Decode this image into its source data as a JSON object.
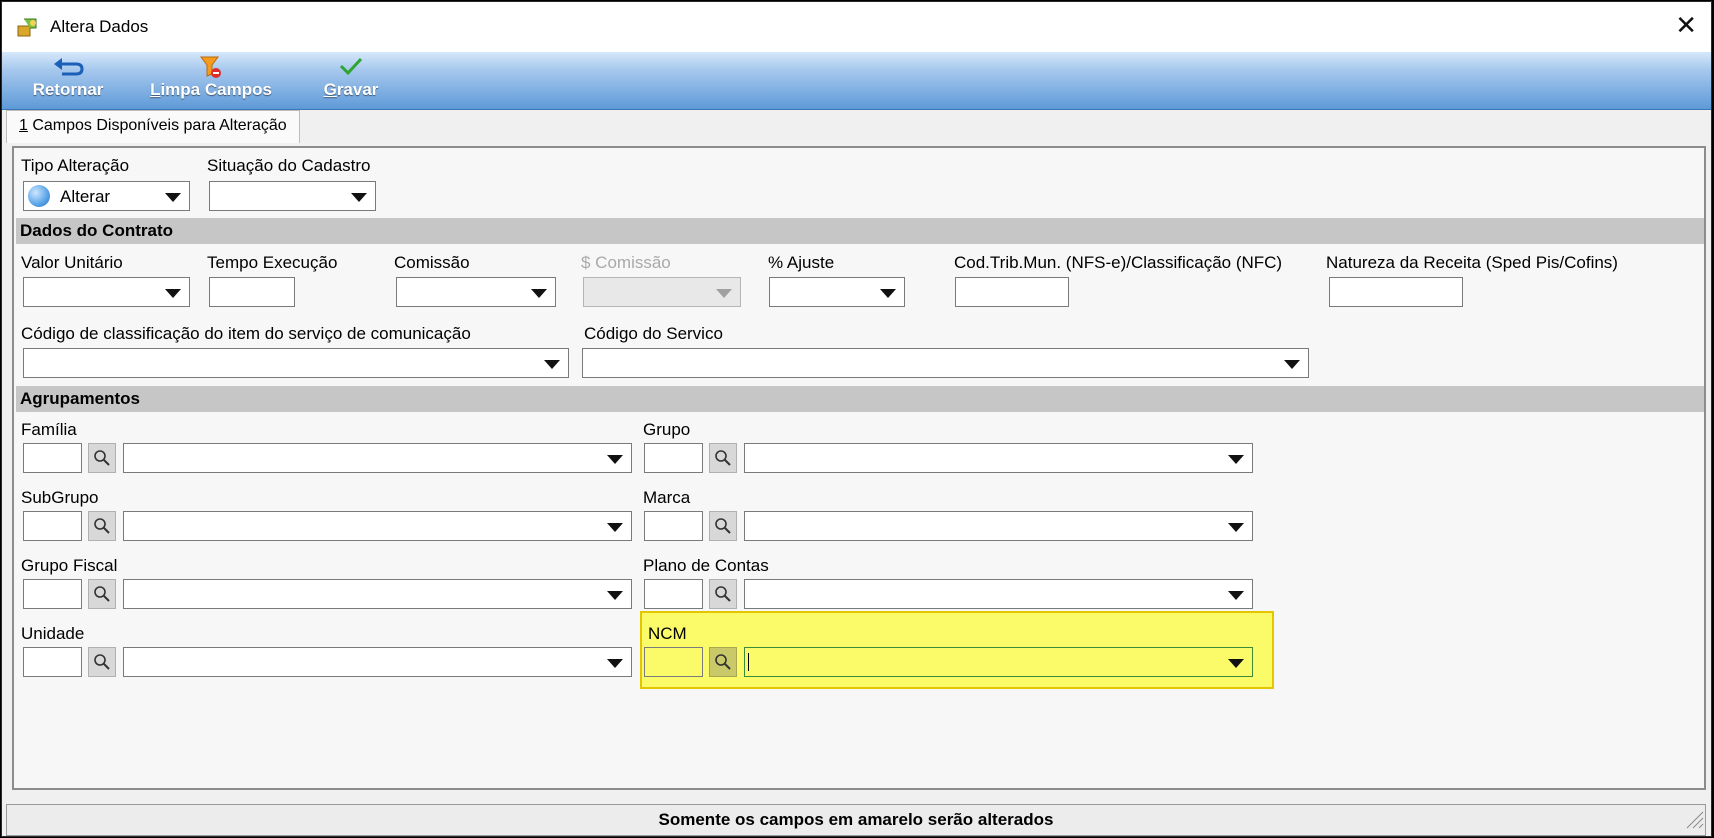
{
  "window": {
    "title": "Altera Dados",
    "close_glyph": "✕"
  },
  "toolbar": {
    "retornar": {
      "hotkey": "",
      "rest": "Retornar",
      "icon": "undo-arrow-icon"
    },
    "limpa_campos": {
      "hotkey": "L",
      "rest": "impa Campos",
      "icon": "filter-clear-icon"
    },
    "gravar": {
      "hotkey": "G",
      "rest": "ravar",
      "icon": "checkmark-icon"
    }
  },
  "tabs": [
    {
      "hotkey": "1",
      "label": " Campos Disponíveis para Alteração"
    }
  ],
  "top": {
    "tipo_alteracao": {
      "label": "Tipo Alteração",
      "value": "Alterar",
      "icon": "globe-icon"
    },
    "situacao_cadastro": {
      "label": "Situação do Cadastro",
      "value": ""
    }
  },
  "dados_contrato": {
    "title": "Dados do Contrato",
    "valor_unitario": "Valor Unitário",
    "tempo_execucao": "Tempo Execução",
    "comissao": "Comissão",
    "s_comissao": "$ Comissão",
    "ajuste": "% Ajuste",
    "cod_trib": "Cod.Trib.Mun. (NFS-e)/Classificação (NFC)",
    "natureza_receita": "Natureza da Receita (Sped Pis/Cofins)",
    "codigo_classificacao": "Código de classificação do item do serviço de comunicação",
    "codigo_servico": "Código do Servico"
  },
  "agrupamentos": {
    "title": "Agrupamentos",
    "familia": "Família",
    "grupo": "Grupo",
    "subgrupo": "SubGrupo",
    "marca": "Marca",
    "grupo_fiscal": "Grupo Fiscal",
    "plano_contas": "Plano de Contas",
    "unidade": "Unidade",
    "ncm": "NCM"
  },
  "colors": {
    "highlight": "#fbfb6a",
    "highlight_border": "#e5c400",
    "section_bg": "#c6c6c6",
    "toolbar_bottom": "#5e9ad8"
  },
  "status": {
    "message": "Somente os campos em amarelo serão alterados"
  }
}
